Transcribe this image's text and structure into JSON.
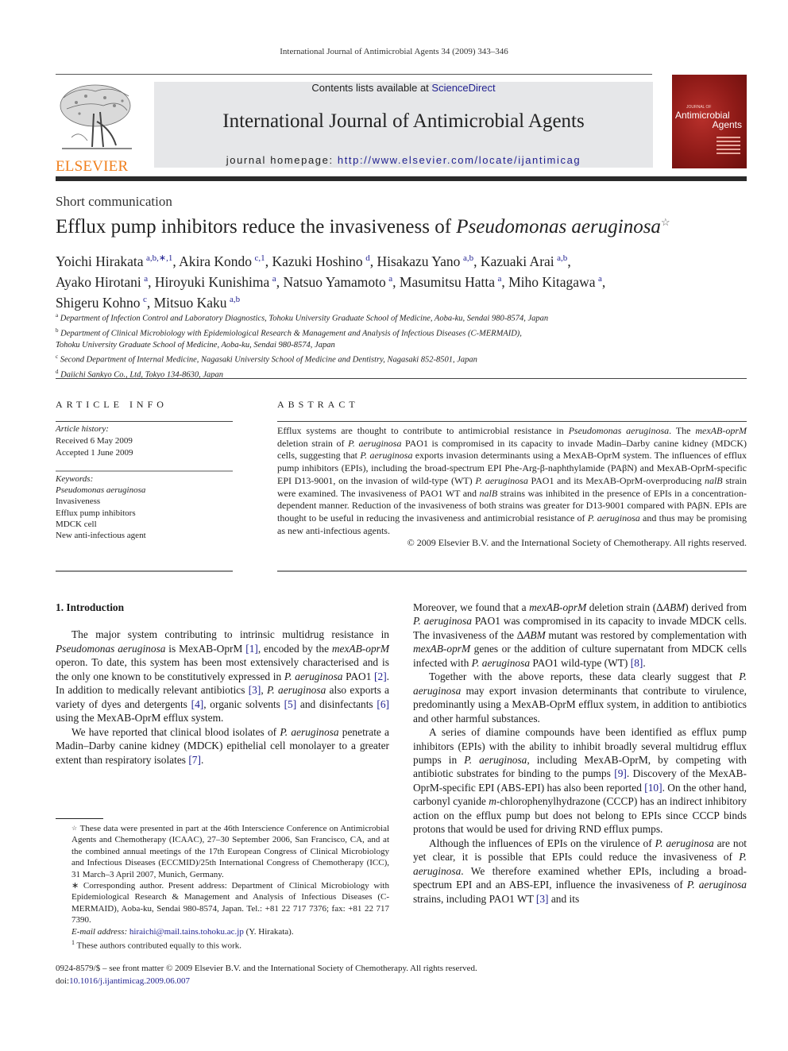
{
  "running_head": "International Journal of Antimicrobial Agents 34 (2009) 343–346",
  "header": {
    "publisher_logo_text": "ELSEVIER",
    "contents_prefix": "Contents lists available at ",
    "contents_link": "ScienceDirect",
    "journal_name": "International Journal of Antimicrobial Agents",
    "homepage_prefix": "journal homepage: ",
    "homepage_url": "http://www.elsevier.com/locate/ijantimicag",
    "cover": {
      "small_text": "JOURNAL OF",
      "title_line1": "Antimicrobial",
      "title_line2": "Agents",
      "background_color": "#9a1f1b"
    },
    "brand_color": "#f07f1d",
    "banner_color": "#e6e7e9"
  },
  "article": {
    "type": "Short communication",
    "title_main": "Efflux pump inhibitors reduce the invasiveness of ",
    "title_italic": "Pseudomonas aeruginosa",
    "title_mark": "☆",
    "authors": [
      {
        "name": "Yoichi Hirakata",
        "sup": "a,b,∗,1",
        "sep": ", "
      },
      {
        "name": "Akira Kondo",
        "sup": "c,1",
        "sep": ", "
      },
      {
        "name": "Kazuki Hoshino",
        "sup": "d",
        "sep": ", "
      },
      {
        "name": "Hisakazu Yano",
        "sup": "a,b",
        "sep": ", "
      },
      {
        "name": "Kazuaki Arai",
        "sup": "a,b",
        "sep": ","
      },
      {
        "name": "Ayako Hirotani",
        "sup": "a",
        "sep": ", "
      },
      {
        "name": "Hiroyuki Kunishima",
        "sup": "a",
        "sep": ", "
      },
      {
        "name": "Natsuo Yamamoto",
        "sup": "a",
        "sep": ", "
      },
      {
        "name": "Masumitsu Hatta",
        "sup": "a",
        "sep": ", "
      },
      {
        "name": "Miho Kitagawa",
        "sup": "a",
        "sep": ","
      },
      {
        "name": "Shigeru Kohno",
        "sup": "c",
        "sep": ", "
      },
      {
        "name": "Mitsuo Kaku",
        "sup": "a,b",
        "sep": ""
      }
    ],
    "affiliations": [
      {
        "label": "a",
        "text": "Department of Infection Control and Laboratory Diagnostics, Tohoku University Graduate School of Medicine, Aoba-ku, Sendai 980-8574, Japan"
      },
      {
        "label": "b",
        "text": "Department of Clinical Microbiology with Epidemiological Research & Management and Analysis of Infectious Diseases (C-MERMAID),"
      },
      {
        "label": "",
        "text": "Tohoku University Graduate School of Medicine, Aoba-ku, Sendai 980-8574, Japan"
      },
      {
        "label": "c",
        "text": "Second Department of Internal Medicine, Nagasaki University School of Medicine and Dentistry, Nagasaki 852-8501, Japan"
      },
      {
        "label": "d",
        "text": "Daiichi Sankyo Co., Ltd, Tokyo 134-8630, Japan"
      }
    ]
  },
  "article_info": {
    "heading": "ARTICLE INFO",
    "history_label": "Article history:",
    "received": "Received 6 May 2009",
    "accepted": "Accepted 1 June 2009",
    "keywords_label": "Keywords:",
    "keywords": [
      "Pseudomonas aeruginosa",
      "Invasiveness",
      "Efflux pump inhibitors",
      "MDCK cell",
      "New anti-infectious agent"
    ]
  },
  "abstract": {
    "heading": "ABSTRACT",
    "segments": [
      {
        "t": "Efflux systems are thought to contribute to antimicrobial resistance in "
      },
      {
        "t": "Pseudomonas aeruginosa",
        "i": true
      },
      {
        "t": ". The "
      },
      {
        "t": "mexAB-oprM",
        "i": true
      },
      {
        "t": " deletion strain of "
      },
      {
        "t": "P. aeruginosa",
        "i": true
      },
      {
        "t": " PAO1 is compromised in its capacity to invade Madin–Darby canine kidney (MDCK) cells, suggesting that "
      },
      {
        "t": "P. aeruginosa",
        "i": true
      },
      {
        "t": " exports invasion determinants using a MexAB-OprM system. The influences of efflux pump inhibitors (EPIs), including the broad-spectrum EPI Phe-Arg-β-naphthylamide (PAβN) and MexAB-OprM-specific EPI D13-9001, on the invasion of wild-type (WT) "
      },
      {
        "t": "P. aeruginosa",
        "i": true
      },
      {
        "t": " PAO1 and its MexAB-OprM-overproducing "
      },
      {
        "t": "nalB",
        "i": true
      },
      {
        "t": " strain were examined. The invasiveness of PAO1 WT and "
      },
      {
        "t": "nalB",
        "i": true
      },
      {
        "t": " strains was inhibited in the presence of EPIs in a concentration-dependent manner. Reduction of the invasiveness of both strains was greater for D13-9001 compared with PAβN. EPIs are thought to be useful in reducing the invasiveness and antimicrobial resistance of "
      },
      {
        "t": "P. aeruginosa",
        "i": true
      },
      {
        "t": " and thus may be promising as new anti-infectious agents."
      }
    ],
    "copyright": "© 2009 Elsevier B.V. and the International Society of Chemotherapy. All rights reserved."
  },
  "body": {
    "section_heading": "1.  Introduction",
    "left_paragraphs": [
      [
        {
          "t": "The major system contributing to intrinsic multidrug resistance in "
        },
        {
          "t": "Pseudomonas aeruginosa",
          "i": true
        },
        {
          "t": " is MexAB-OprM "
        },
        {
          "t": "[1]",
          "ref": true
        },
        {
          "t": ", encoded by the "
        },
        {
          "t": "mexAB-oprM",
          "i": true
        },
        {
          "t": " operon. To date, this system has been most extensively characterised and is the only one known to be constitutively expressed in "
        },
        {
          "t": "P. aeruginosa",
          "i": true
        },
        {
          "t": " PAO1 "
        },
        {
          "t": "[2]",
          "ref": true
        },
        {
          "t": ". In addition to medically relevant antibiotics "
        },
        {
          "t": "[3]",
          "ref": true
        },
        {
          "t": ", "
        },
        {
          "t": "P. aeruginosa",
          "i": true
        },
        {
          "t": " also exports a variety of dyes and detergents "
        },
        {
          "t": "[4]",
          "ref": true
        },
        {
          "t": ", organic solvents "
        },
        {
          "t": "[5]",
          "ref": true
        },
        {
          "t": " and disinfectants "
        },
        {
          "t": "[6]",
          "ref": true
        },
        {
          "t": " using the MexAB-OprM efflux system."
        }
      ],
      [
        {
          "t": "We have reported that clinical blood isolates of "
        },
        {
          "t": "P. aeruginosa",
          "i": true
        },
        {
          "t": " penetrate a Madin–Darby canine kidney (MDCK) epithelial cell monolayer to a greater extent than respiratory isolates "
        },
        {
          "t": "[7]",
          "ref": true
        },
        {
          "t": "."
        }
      ]
    ],
    "right_paragraphs": [
      [
        {
          "t": "Moreover, we found that a "
        },
        {
          "t": "mexAB-oprM",
          "i": true
        },
        {
          "t": " deletion strain (Δ"
        },
        {
          "t": "ABM",
          "i": true
        },
        {
          "t": ") derived from "
        },
        {
          "t": "P. aeruginosa",
          "i": true
        },
        {
          "t": " PAO1 was compromised in its capacity to invade MDCK cells. The invasiveness of the Δ"
        },
        {
          "t": "ABM",
          "i": true
        },
        {
          "t": " mutant was restored by complementation with "
        },
        {
          "t": "mexAB-oprM",
          "i": true
        },
        {
          "t": " genes or the addition of culture supernatant from MDCK cells infected with "
        },
        {
          "t": "P. aeruginosa",
          "i": true
        },
        {
          "t": " PAO1 wild-type (WT) "
        },
        {
          "t": "[8]",
          "ref": true
        },
        {
          "t": "."
        }
      ],
      [
        {
          "t": "Together with the above reports, these data clearly suggest that "
        },
        {
          "t": "P. aeruginosa",
          "i": true
        },
        {
          "t": " may export invasion determinants that contribute to virulence, predominantly using a MexAB-OprM efflux system, in addition to antibiotics and other harmful substances."
        }
      ],
      [
        {
          "t": "A series of diamine compounds have been identified as efflux pump inhibitors (EPIs) with the ability to inhibit broadly several multidrug efflux pumps in "
        },
        {
          "t": "P. aeruginosa",
          "i": true
        },
        {
          "t": ", including MexAB-OprM, by competing with antibiotic substrates for binding to the pumps "
        },
        {
          "t": "[9]",
          "ref": true
        },
        {
          "t": ". Discovery of the MexAB-OprM-specific EPI (ABS-EPI) has also been reported "
        },
        {
          "t": "[10]",
          "ref": true
        },
        {
          "t": ". On the other hand, carbonyl cyanide "
        },
        {
          "t": "m",
          "i": true
        },
        {
          "t": "-chlorophenylhydrazone (CCCP) has an indirect inhibitory action on the efflux pump but does not belong to EPIs since CCCP binds protons that would be used for driving RND efflux pumps."
        }
      ],
      [
        {
          "t": "Although the influences of EPIs on the virulence of "
        },
        {
          "t": "P. aeruginosa",
          "i": true
        },
        {
          "t": " are not yet clear, it is possible that EPIs could reduce the invasiveness of "
        },
        {
          "t": "P. aeruginosa",
          "i": true
        },
        {
          "t": ". We therefore examined whether EPIs, including a broad-spectrum EPI and an ABS-EPI, influence the invasiveness of "
        },
        {
          "t": "P. aeruginosa",
          "i": true
        },
        {
          "t": " strains, including PAO1 WT "
        },
        {
          "t": "[3]",
          "ref": true
        },
        {
          "t": " and its"
        }
      ]
    ]
  },
  "footnotes": {
    "star_mark": "☆",
    "star_text": " These data were presented in part at the 46th Interscience Conference on Antimicrobial Agents and Chemotherapy (ICAAC), 27–30 September 2006, San Francisco, CA, and at the combined annual meetings of the 17th European Congress of Clinical Microbiology and Infectious Diseases (ECCMID)/25th International Congress of Chemotherapy (ICC), 31 March–3 April 2007, Munich, Germany.",
    "corresponding_mark": "∗",
    "corresponding_text": "  Corresponding author. Present address: Department of Clinical Microbiology with Epidemiological Research & Management and Analysis of Infectious Diseases (C-MERMAID), Aoba-ku, Sendai 980-8574, Japan. Tel.: +81 22 717 7376; fax: +81 22 717 7390.",
    "email_label": "E-mail address: ",
    "email": "hiraichi@mail.tains.tohoku.ac.jp",
    "email_suffix": " (Y. Hirakata).",
    "equal_mark": "1",
    "equal_text": " These authors contributed equally to this work."
  },
  "bottom": {
    "issn_line": "0924-8579/$ – see front matter © 2009 Elsevier B.V. and the International Society of Chemotherapy. All rights reserved.",
    "doi_prefix": "doi:",
    "doi": "10.1016/j.ijantimicag.2009.06.007"
  }
}
